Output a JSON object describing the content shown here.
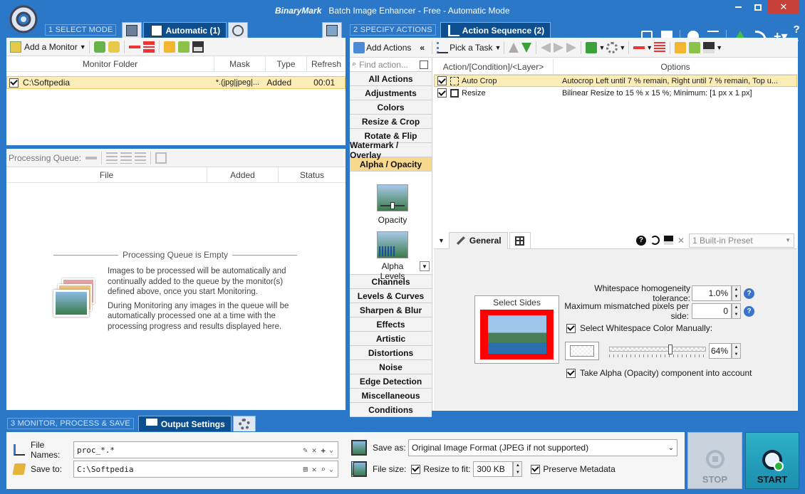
{
  "window": {
    "brand": "BinaryMark",
    "title": "Batch Image Enhancer - Free - Automatic Mode"
  },
  "step1": {
    "label": "1 SELECT MODE",
    "tab_active": "Automatic (1)"
  },
  "step2": {
    "label": "2 SPECIFY ACTIONS",
    "tab_active": "Action Sequence (2)"
  },
  "step3": {
    "label": "3 MONITOR, PROCESS & SAVE",
    "tab_active": "Output Settings"
  },
  "monitor_toolbar": {
    "add_monitor": "Add a Monitor"
  },
  "monitor_table": {
    "columns": [
      "Monitor Folder",
      "Mask",
      "Type",
      "Refresh"
    ],
    "rows": [
      {
        "folder": "C:\\Softpedia",
        "mask": "*.(jpg|jpeg|...",
        "type": "Added",
        "refresh": "00:01"
      }
    ]
  },
  "queue": {
    "label": "Processing Queue:",
    "columns": [
      "File",
      "Added",
      "Status"
    ],
    "empty_title": "Processing Queue is Empty",
    "empty_p1": "Images to be processed will be automatically and continually added to the queue by the monitor(s) defined above, once you start Monitoring.",
    "empty_p2": "During Monitoring any images in the queue will be automatically processed one at a time with the processing progress and results displayed here."
  },
  "actions_toolbar": {
    "add_actions": "Add Actions",
    "pick_task": "Pick a Task"
  },
  "find_action": {
    "placeholder": "Find action..."
  },
  "categories_top": [
    "All Actions",
    "Adjustments",
    "Colors",
    "Resize & Crop",
    "Rotate & Flip",
    "Watermark / Overlay",
    "Alpha / Opacity"
  ],
  "category_items": [
    "Opacity",
    "Alpha Levels"
  ],
  "categories_bottom": [
    "Channels",
    "Levels & Curves",
    "Sharpen & Blur",
    "Effects",
    "Artistic",
    "Distortions",
    "Noise",
    "Edge Detection",
    "Miscellaneous",
    "Conditions"
  ],
  "sequence": {
    "columns": [
      "Action/[Condition]/<Layer>",
      "Options"
    ],
    "rows": [
      {
        "action": "Auto Crop",
        "options": "Autocrop  Left  until  7  %  remain,  Right  until  7  %  remain,  Top  u..."
      },
      {
        "action": "Resize",
        "options": "Bilinear Resize to 15 % x 15 %; Minimum: [1 px x 1 px]"
      }
    ]
  },
  "settings": {
    "tab": "General",
    "preset": "1 Built-in Preset",
    "select_sides": "Select Sides",
    "tolerance_label": "Whitespace homogeneity tolerance:",
    "tolerance_value": "1.0%",
    "mismatch_label": "Maximum mismatched pixels per side:",
    "mismatch_value": "0",
    "select_color_label": "Select Whitespace Color Manually:",
    "opacity_value": "64%",
    "opacity_level": 0.64,
    "alpha_label": "Take Alpha (Opacity) component into account"
  },
  "output": {
    "file_names_label": "File Names:",
    "file_names_value": "proc_*.*",
    "save_to_label": "Save to:",
    "save_to_value": "C:\\Softpedia",
    "save_as_label": "Save as:",
    "save_as_value": "Original Image Format (JPEG if not supported)",
    "file_size_label": "File size:",
    "resize_label": "Resize to fit:",
    "resize_value": "300 KB",
    "preserve_label": "Preserve Metadata"
  },
  "buttons": {
    "stop": "STOP",
    "start": "START"
  },
  "colors": {
    "accent": "#0d4e8f",
    "chrome": "#2b78c8",
    "selected": "#f7d88c",
    "red": "#ff0000"
  }
}
